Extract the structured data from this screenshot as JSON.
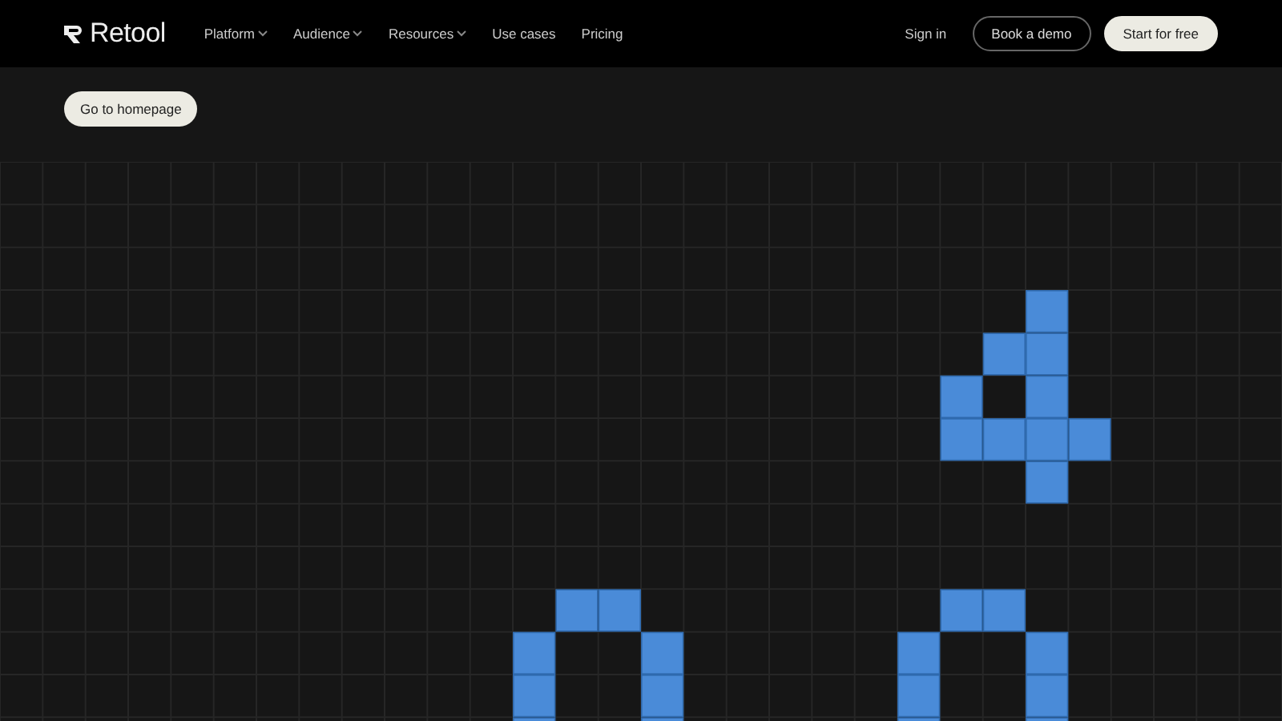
{
  "navbar": {
    "logo": "Retool",
    "links": [
      {
        "label": "Platform",
        "has_menu": true
      },
      {
        "label": "Audience",
        "has_menu": true
      },
      {
        "label": "Resources",
        "has_menu": true
      },
      {
        "label": "Use cases",
        "has_menu": false
      },
      {
        "label": "Pricing",
        "has_menu": false
      }
    ],
    "sign_in": "Sign in",
    "book_demo": "Book a demo",
    "start_free": "Start for free"
  },
  "home_button": "Go to homepage"
}
